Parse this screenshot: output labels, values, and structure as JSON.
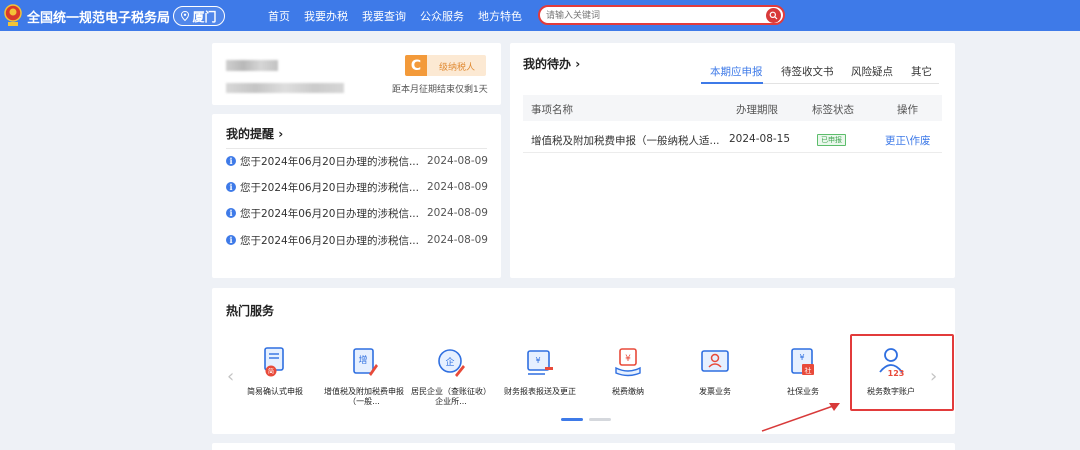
{
  "header": {
    "site_title": "全国统一规范电子税务局",
    "city": "厦门",
    "nav": [
      "首页",
      "我要办税",
      "我要查询",
      "公众服务",
      "地方特色"
    ],
    "search_placeholder": "请输入关键词",
    "accent_color": "#3e7ae8"
  },
  "profile": {
    "grade_letter": "C",
    "grade_label": "级纳税人",
    "deadline_text": "距本月征期结束仅剩1天"
  },
  "reminders": {
    "title": "我的提醒",
    "items": [
      {
        "text": "您于2024年06月20日办理的涉税信...",
        "date": "2024-08-09"
      },
      {
        "text": "您于2024年06月20日办理的涉税信...",
        "date": "2024-08-09"
      },
      {
        "text": "您于2024年06月20日办理的涉税信...",
        "date": "2024-08-09"
      },
      {
        "text": "您于2024年06月20日办理的涉税信...",
        "date": "2024-08-09"
      }
    ]
  },
  "todo": {
    "title": "我的待办",
    "tabs": [
      "本期应申报",
      "待签收文书",
      "风险疑点",
      "其它"
    ],
    "columns": [
      "事项名称",
      "办理期限",
      "标签状态",
      "操作"
    ],
    "rows": [
      {
        "name": "增值税及附加税费申报（一般纳税人适...",
        "deadline": "2024-08-15",
        "status": "已申报",
        "action": "更正\\作废"
      }
    ]
  },
  "hot_services": {
    "title": "热门服务",
    "items": [
      {
        "label": "简易确认式申报",
        "icon": "document-stamp-icon"
      },
      {
        "label": "增值税及附加税费申报（一般...",
        "icon": "vat-declare-icon"
      },
      {
        "label": "居民企业（查账征收）企业所...",
        "icon": "enterprise-tax-icon"
      },
      {
        "label": "财务报表报送及更正",
        "icon": "financial-report-icon"
      },
      {
        "label": "税费缴纳",
        "icon": "tax-payment-icon"
      },
      {
        "label": "发票业务",
        "icon": "invoice-icon"
      },
      {
        "label": "社保业务",
        "icon": "social-security-icon"
      },
      {
        "label": "税务数字账户",
        "icon": "digital-account-icon"
      }
    ]
  }
}
